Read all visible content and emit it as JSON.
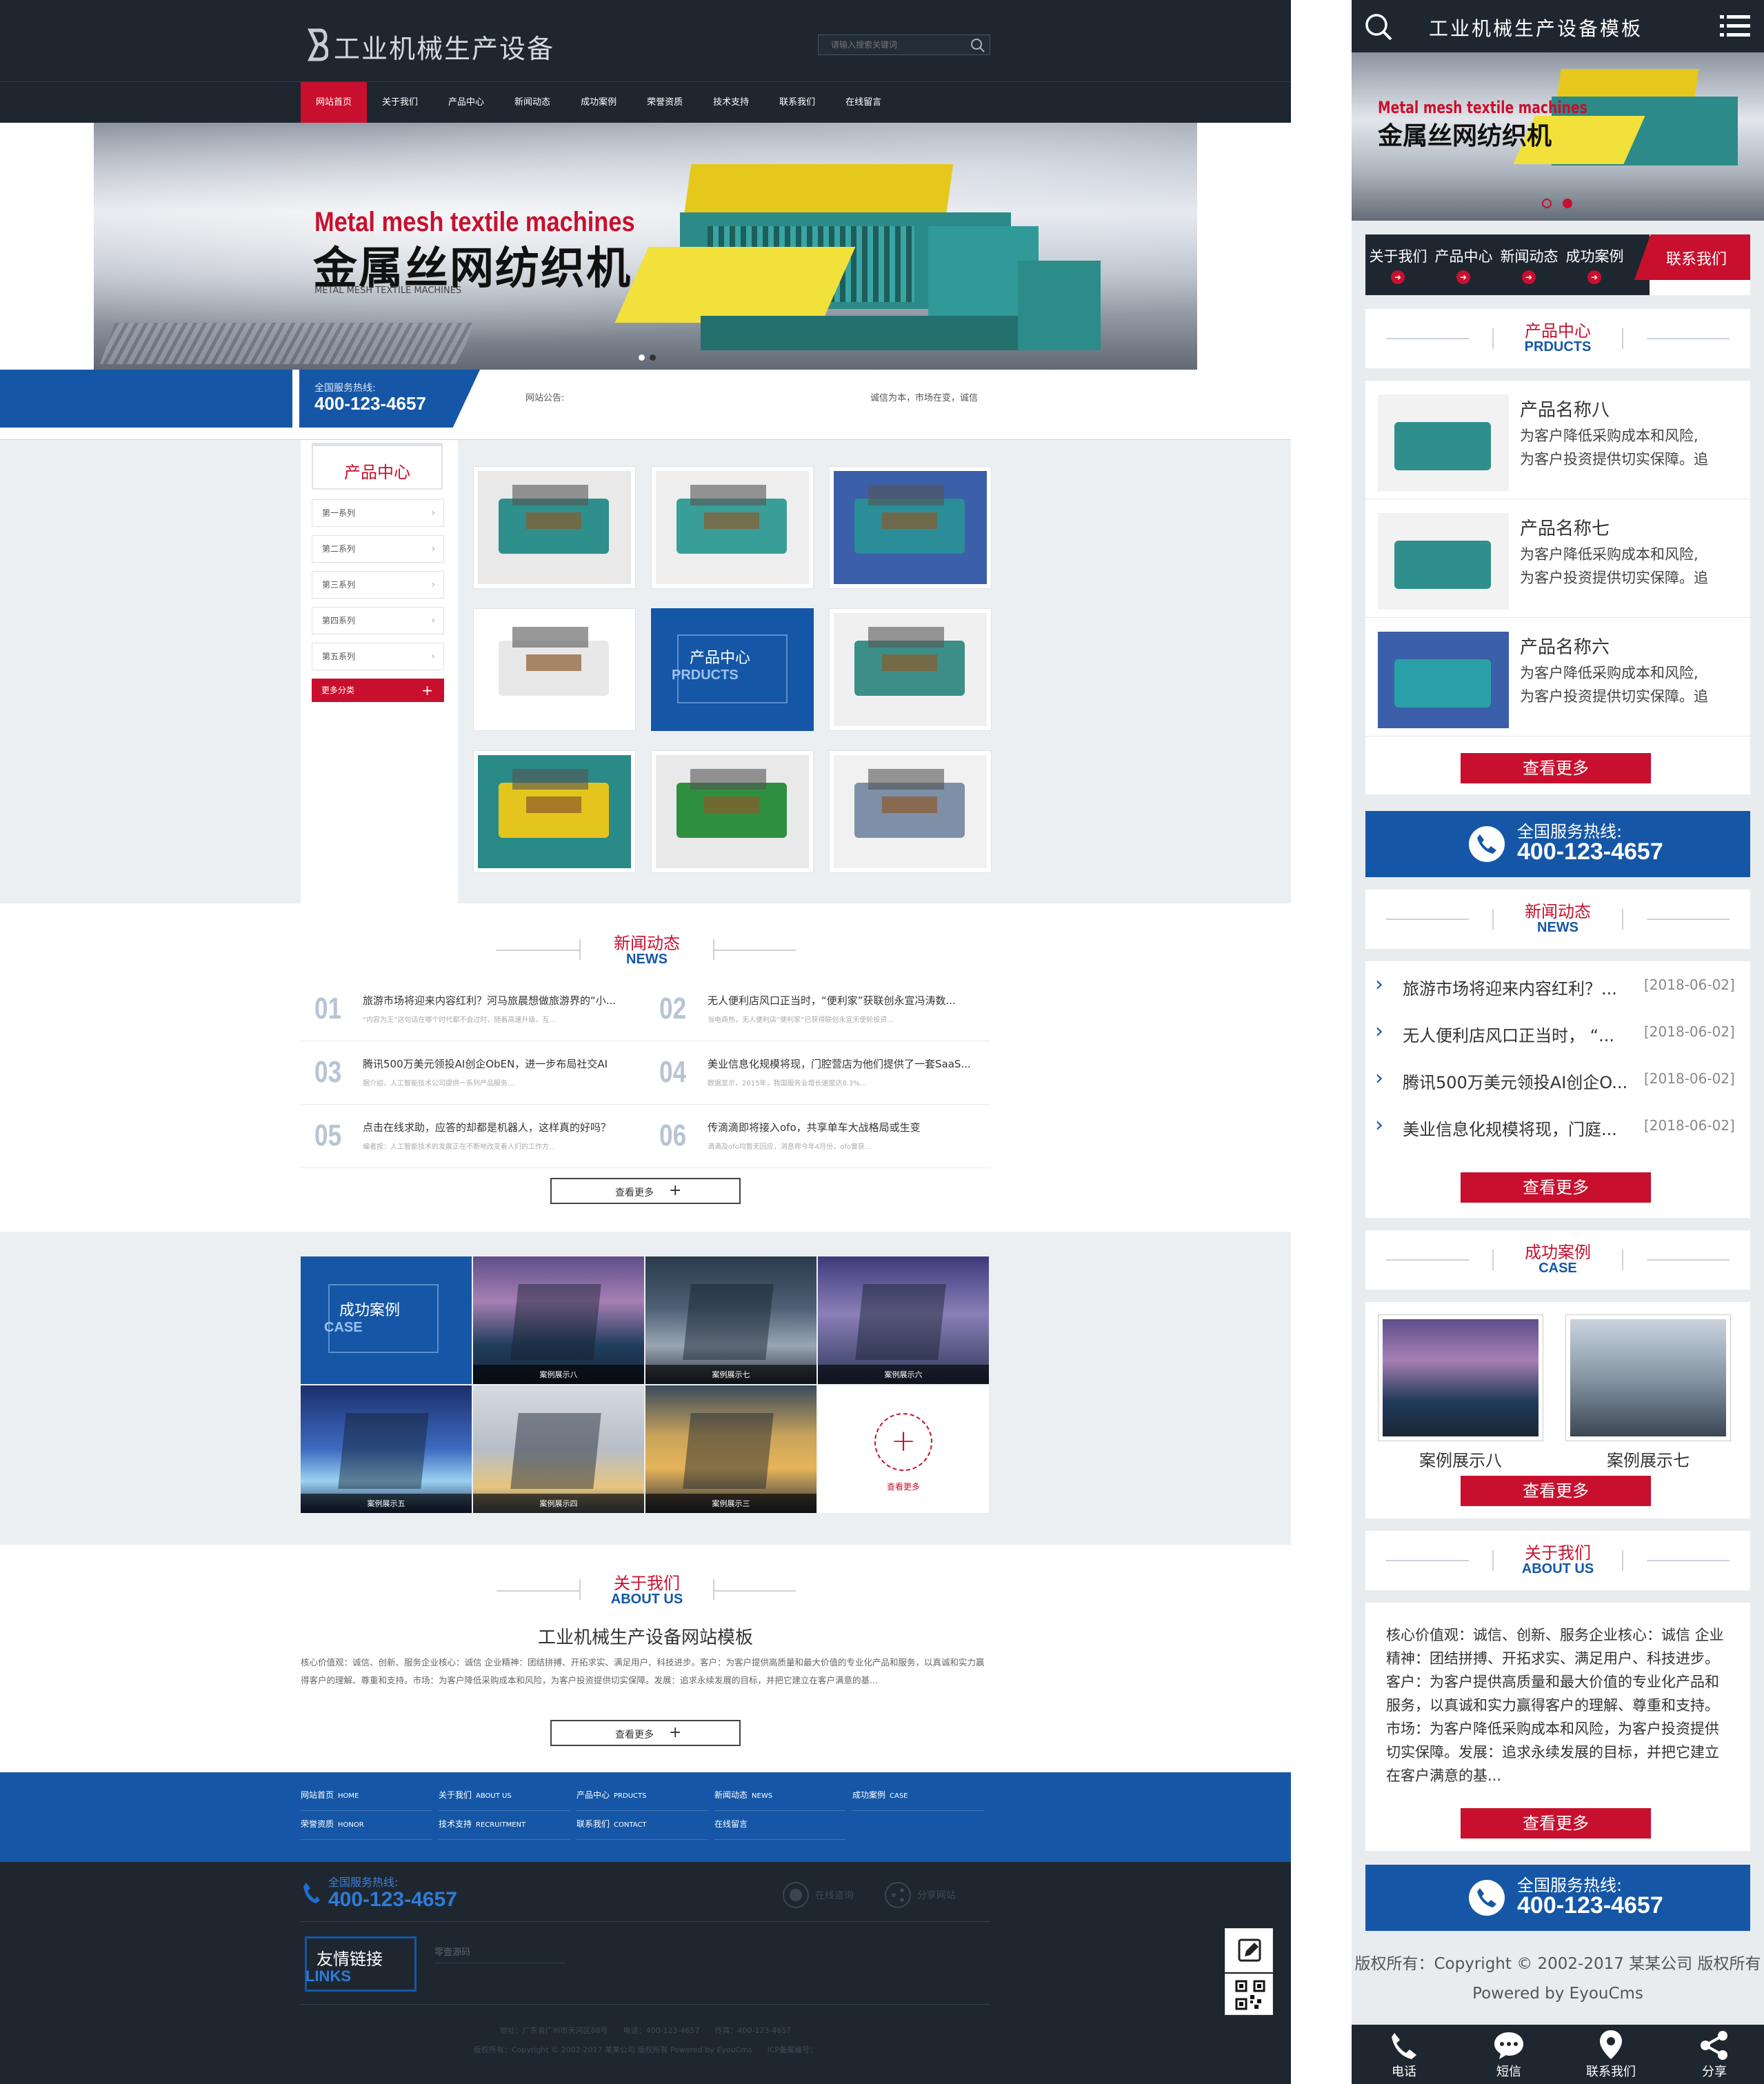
{
  "header": {
    "site_title": "工业机械生产设备",
    "search_placeholder": "请输入搜索关键词"
  },
  "nav": [
    "网站首页",
    "关于我们",
    "产品中心",
    "新闻动态",
    "成功案例",
    "荣誉资质",
    "技术支持",
    "联系我们",
    "在线留言"
  ],
  "banner": {
    "title_en": "Metal mesh textile machines",
    "title_cn": "金属丝网纺织机",
    "sub_en": "METAL MESH TEXTILE MACHINES"
  },
  "hotline": {
    "label": "全国服务热线:",
    "number": "400-123-4657"
  },
  "notice": {
    "label": "网站公告:",
    "text": "诚信为本，市场在变，诚信"
  },
  "products": {
    "title_cn": "产品中心",
    "title_en": "PRDUCTS",
    "categories": [
      "第一系列",
      "第二系列",
      "第三系列",
      "第四系列",
      "第五系列"
    ],
    "more": "更多分类",
    "plus": "+"
  },
  "news": {
    "title_cn": "新闻动态",
    "title_en": "NEWS",
    "items": [
      {
        "num": "01",
        "title": "旅游市场将迎来内容红利？河马旅晨想做旅游界的“小...",
        "summary": "“内容为王”这句话在哪个时代都不会过时，随着高速升级，互..."
      },
      {
        "num": "02",
        "title": "无人便利店风口正当时，“便利家”获联创永宣冯涛数...",
        "summary": "当电商热，无人便利店“便利家”已获得联创永宣天使轮投资..."
      },
      {
        "num": "03",
        "title": "腾讯500万美元领投AI创企ObEN，进一步布局社交AI",
        "summary": "据介绍，人工智能技术公司提供一系列产品服务..."
      },
      {
        "num": "04",
        "title": "美业信息化规模将现，门腔营店为他们提供了一套SaaS...",
        "summary": "数据显示，2015年，我国服务业增长速度达8.3%..."
      },
      {
        "num": "05",
        "title": "点击在线求助，应答的却都是机器人，这样真的好吗？",
        "summary": "编者按：人工智能技术的发展正在不断地改变着人们的工作方..."
      },
      {
        "num": "06",
        "title": "传滴滴即将接入ofo，共享单车大战格局或生变",
        "summary": "滴滴及ofo均暂无回应，消息称今年4月份，ofo曾获..."
      }
    ],
    "more": "查看更多",
    "plus": "+"
  },
  "cases": {
    "title_cn": "成功案例",
    "title_en": "CASE",
    "items": [
      "案例展示八",
      "案例展示七",
      "案例展示六",
      "案例展示五",
      "案例展示四",
      "案例展示三"
    ],
    "more": "查看更多"
  },
  "about": {
    "title_cn": "关于我们",
    "title_en": "ABOUT US",
    "heading": "工业机械生产设备网站模板",
    "text": "核心价值观：诚信、创新、服务企业核心：诚信 企业精神：团结拼搏、开拓求实、满足用户、科技进步。客户：为客户提供高质量和最大价值的专业化产品和服务，以真诚和实力赢得客户的理解、尊重和支持。市场：为客户降低采购成本和风险，为客户投资提供切实保障。发展：追求永续发展的目标，并把它建立在客户满意的基...",
    "more": "查看更多",
    "plus": "+"
  },
  "footer_links": [
    {
      "cn": "网站首页",
      "en": "HOME"
    },
    {
      "cn": "关于我们",
      "en": "ABOUT US"
    },
    {
      "cn": "产品中心",
      "en": "PRDUCTS"
    },
    {
      "cn": "新闻动态",
      "en": "NEWS"
    },
    {
      "cn": "成功案例",
      "en": "CASE"
    },
    {
      "cn": "荣誉资质",
      "en": "HONOR"
    },
    {
      "cn": "技术支持",
      "en": "RECRUITMENT"
    },
    {
      "cn": "联系我们",
      "en": "CONTACT"
    },
    {
      "cn": "在线留言",
      "en": ""
    }
  ],
  "footer": {
    "online": "在线咨询",
    "share": "分享网站",
    "links_cn": "友情链接",
    "links_en": "LINKS",
    "link1": "零壹源码",
    "address": "地址：广东省广州市天河区88号　　电话：400-123-4657　　传真：400-123-4657",
    "copyright": "版权所有：Copyright © 2002-2017 某某公司 版权所有 Powered by EyouCms　　ICP备案编号："
  },
  "mobile": {
    "title": "工业机械生产设备模板",
    "nav": [
      "关于我们",
      "产品中心",
      "新闻动态",
      "成功案例"
    ],
    "contact": "联系我们",
    "products": [
      {
        "name": "产品名称八",
        "desc1": "为客户降低采购成本和风险,",
        "desc2": "为客户投资提供切实保障。追"
      },
      {
        "name": "产品名称七",
        "desc1": "为客户降低采购成本和风险,",
        "desc2": "为客户投资提供切实保障。追"
      },
      {
        "name": "产品名称六",
        "desc1": "为客户降低采购成本和风险,",
        "desc2": "为客户投资提供切实保障。追"
      }
    ],
    "more": "查看更多",
    "news": [
      {
        "title": "旅游市场将迎来内容红利？...",
        "date": "[2018-06-02]"
      },
      {
        "title": "无人便利店风口正当时，  “...",
        "date": "[2018-06-02]"
      },
      {
        "title": "腾讯500万美元领投AI创企O...",
        "date": "[2018-06-02]"
      },
      {
        "title": "美业信息化规模将现，门庭...",
        "date": "[2018-06-02]"
      }
    ],
    "cases": [
      "案例展示八",
      "案例展示七"
    ],
    "about": "核心价值观：诚信、创新、服务企业核心：诚信 企业精神：团结拼搏、开拓求实、满足用户、科技进步。客户：为客户提供高质量和最大价值的专业化产品和服务，以真诚和实力赢得客户的理解、尊重和支持。市场：为客户降低采购成本和风险，为客户投资提供切实保障。发展：追求永续发展的目标，并把它建立在客户满意的基...",
    "copyright": "版权所有：Copyright © 2002-2017 某某公司 版权所有",
    "powered": "Powered by EyouCms",
    "bottom": [
      "电话",
      "短信",
      "联系我们",
      "分享"
    ]
  }
}
